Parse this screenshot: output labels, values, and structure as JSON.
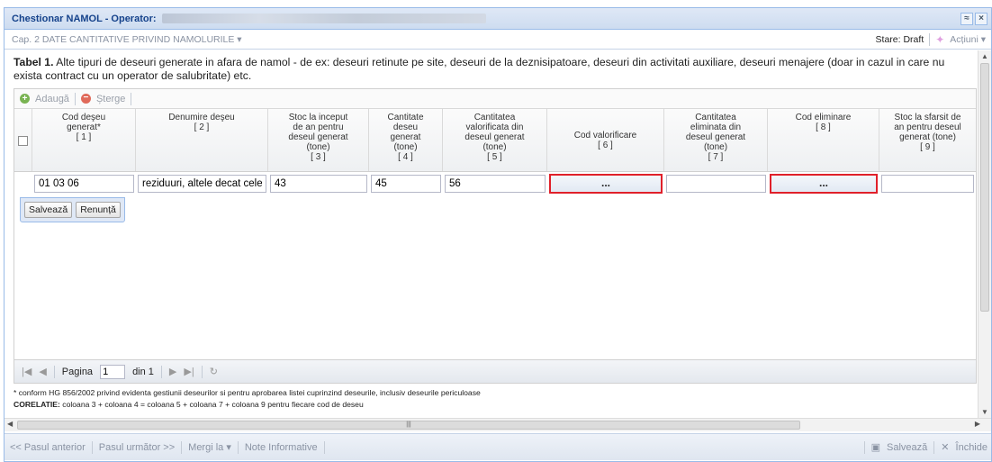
{
  "window": {
    "title": "Chestionar NAMOL - Operator:",
    "tools": [
      "≈",
      "×"
    ]
  },
  "subbar": {
    "chapter": "Cap. 2 DATE CANTITATIVE PRIVIND NAMOLURILE ▾",
    "status": "Stare: Draft",
    "actions": "Acțiuni ▾"
  },
  "table_title": {
    "bold": "Tabel 1.",
    "text": " Alte tipuri de deseuri generate in afara de namol - de ex: deseuri retinute pe site, deseuri de la deznisipatoare, deseuri din activitati auxiliare, deseuri menajere (doar in cazul in care nu exista contract cu un operator de salubritate) etc."
  },
  "toolbar": {
    "add": "Adaugă",
    "delete": "Șterge"
  },
  "columns": [
    {
      "label": "Cod deşeu generat*",
      "num": "[ 1 ]"
    },
    {
      "label": "Denumire deşeu",
      "num": "[ 2 ]"
    },
    {
      "label": "Stoc la inceput de an pentru deseul generat (tone)",
      "num": "[ 3 ]"
    },
    {
      "label": "Cantitate deseu generat (tone)",
      "num": "[ 4 ]"
    },
    {
      "label": "Cantitatea valorificata din deseul generat (tone)",
      "num": "[ 5 ]"
    },
    {
      "label": "Cod valorificare",
      "num": "[ 6 ]"
    },
    {
      "label": "Cantitatea eliminata din deseul generat (tone)",
      "num": "[ 7 ]"
    },
    {
      "label": "Cod eliminare",
      "num": "[ 8 ]"
    },
    {
      "label": "Stoc la sfarsit de an pentru deseul generat (tone)",
      "num": "[ 9 ]"
    }
  ],
  "edit_row": {
    "cod": "01 03 06",
    "denumire": "reziduuri, altele decat cele",
    "stoc_inceput": "43",
    "cantitate": "45",
    "valorificata": "56",
    "cod_valorificare": "...",
    "eliminata": "",
    "cod_eliminare": "...",
    "stoc_sfarsit": ""
  },
  "editor_buttons": {
    "save": "Salvează",
    "cancel": "Renunță"
  },
  "pager": {
    "page_label": "Pagina",
    "page": "1",
    "of": "din 1"
  },
  "notes": {
    "line1": "* conform HG 856/2002 privind evidenta gestiunii deseurilor si pentru aprobarea listei cuprinzind deseurile, inclusiv deseurile periculoase",
    "line2_bold": "CORELATIE:",
    "line2": " coloana 3 + coloana 4 = coloana 5 + coloana 7 + coloana 9 pentru fiecare cod de deseu"
  },
  "footer": {
    "prev": "<< Pasul anterior",
    "next": "Pasul următor >>",
    "goto": "Mergi la ▾",
    "notes": "Note Informative",
    "save": "Salvează",
    "close": "Închide"
  }
}
